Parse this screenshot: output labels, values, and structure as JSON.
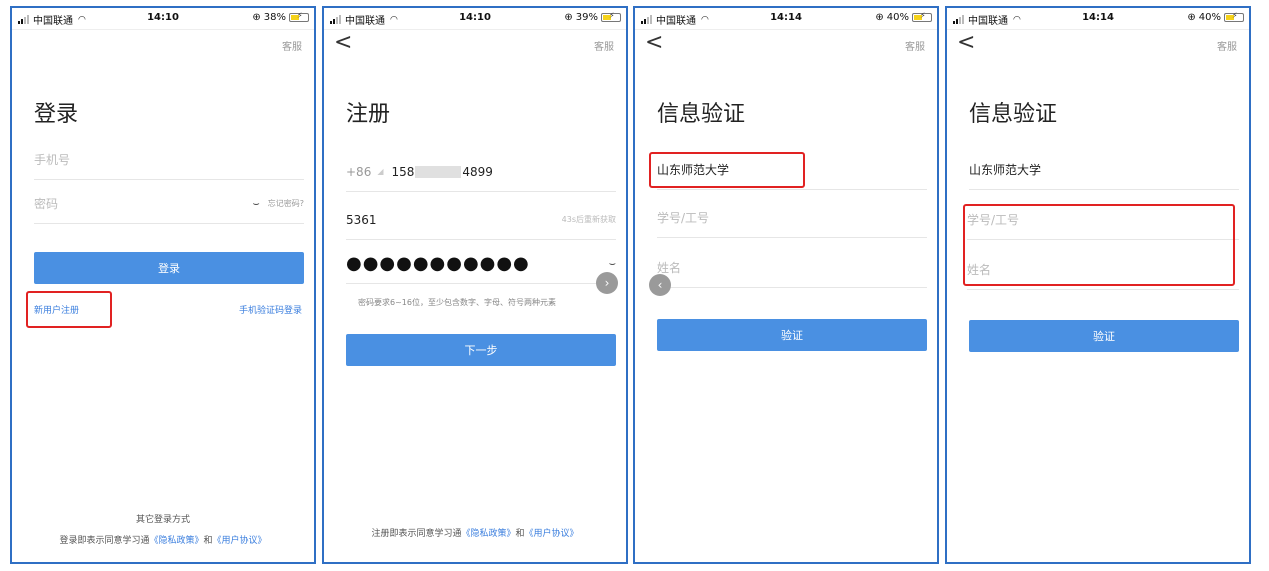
{
  "status": {
    "carrier": "中国联通",
    "p1": {
      "time": "14:10",
      "battery": "38%"
    },
    "p2": {
      "time": "14:10",
      "battery": "39%"
    },
    "p3": {
      "time": "14:14",
      "battery": "40%"
    },
    "p4": {
      "time": "14:14",
      "battery": "40%"
    }
  },
  "common": {
    "customer_service": "客服",
    "back": "<"
  },
  "login": {
    "title": "登录",
    "phone_placeholder": "手机号",
    "password_placeholder": "密码",
    "forgot": "忘记密码?",
    "button": "登录",
    "register_link": "新用户注册",
    "sms_login_link": "手机验证码登录",
    "other_methods": "其它登录方式",
    "agree_prefix": "登录即表示同意学习通",
    "privacy": "《隐私政策》",
    "and": "和",
    "user_agreement": "《用户协议》"
  },
  "register": {
    "title": "注册",
    "country_code": "+86",
    "phone_start": "158",
    "phone_end": "4899",
    "code_value": "5361",
    "resend": "43s后重新获取",
    "password_mask": "●●●●●●●●●●●",
    "hint": "密码要求6~16位，至少包含数字、字母、符号两种元素",
    "button": "下一步",
    "agree_prefix": "注册即表示同意学习通",
    "privacy": "《隐私政策》",
    "and": "和",
    "user_agreement": "《用户协议》"
  },
  "verify": {
    "title": "信息验证",
    "school": "山东师范大学",
    "id_placeholder": "学号/工号",
    "name_placeholder": "姓名",
    "button": "验证"
  },
  "colors": {
    "primary": "#4a90e2",
    "highlight": "#e12222",
    "frame": "#2f6fc4"
  }
}
